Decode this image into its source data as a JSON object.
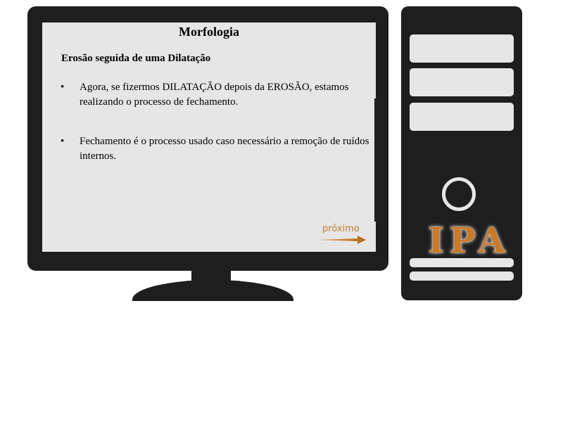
{
  "slide": {
    "title": "Morfologia",
    "subtitle": "Erosão seguida de uma Dilatação",
    "bullet_marker": "•",
    "bullets": [
      "Agora, se fizermos DILATAÇÃO depois da EROSÃO, estamos realizando o processo de fechamento.",
      "Fechamento é o processo usado caso necessário a remoção de ruídos internos."
    ],
    "next_label": "próximo"
  },
  "tower": {
    "logo_text": "IPA"
  },
  "colors": {
    "frame": "#1e1e1e",
    "screen": "#e6e6e6",
    "accent": "#c07c2a"
  },
  "icons": {
    "next": "arrow-right-icon",
    "power": "power-ring-icon"
  }
}
